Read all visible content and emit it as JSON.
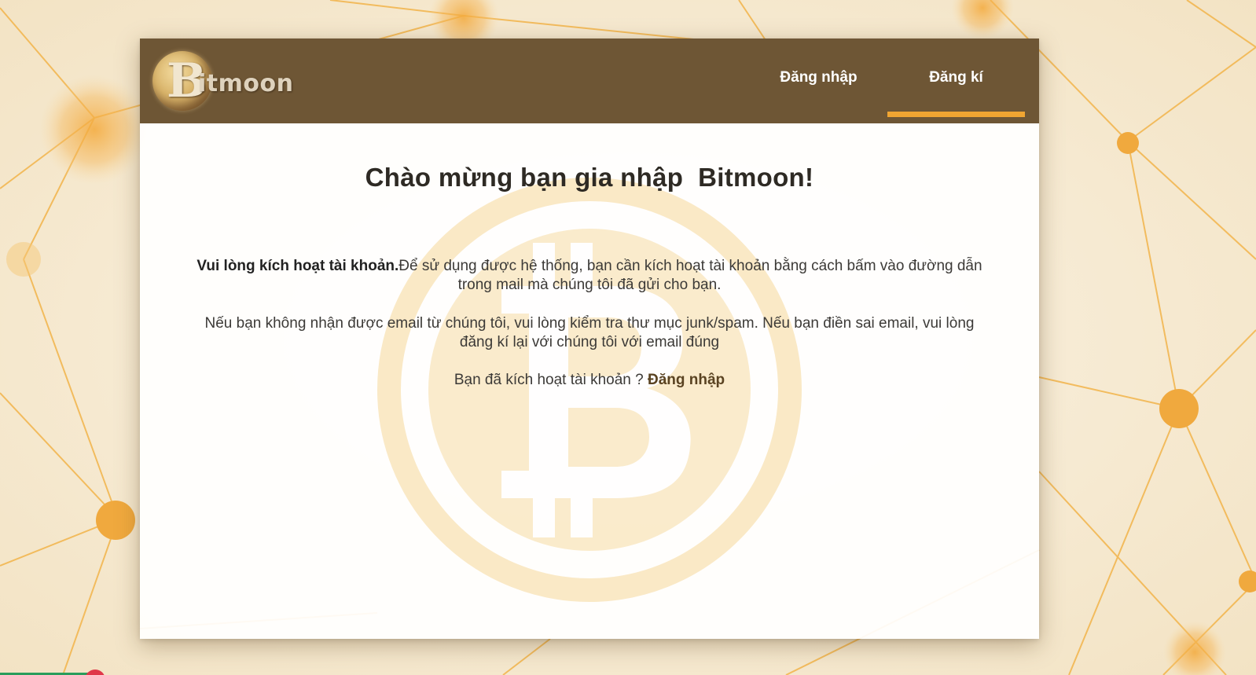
{
  "brand": {
    "logo_text": "Bitmoon",
    "logo_letter": "B"
  },
  "nav": {
    "login_label": "Đăng nhập",
    "register_label": "Đăng kí",
    "active_tab": "register"
  },
  "main": {
    "title": "Chào mừng bạn gia nhập  Bitmoon!",
    "activation_bold": "Vui lòng kích hoạt tài khoản.",
    "activation_text": "Để sử dụng được hệ thống, bạn cần kích hoạt tài khoản bằng cách bấm vào đường dẫn trong mail mà chúng tôi đã gửi cho bạn.",
    "no_email_text": "Nếu bạn không nhận được email từ chúng tôi, vui lòng kiểm tra thư mục junk/spam. Nếu bạn điền sai email, vui lòng đăng kí lại với chúng tôi với email đúng",
    "activated_question": "Bạn đã kích hoạt tài khoản ? ",
    "login_link": "Đăng nhập"
  },
  "colors": {
    "header_bg": "#6e5635",
    "accent": "#f0a532",
    "network": "#f2b44a",
    "page_bg": "#f6ead3"
  },
  "icons": {
    "watermark": "bitcoin-icon",
    "logo": "moon-bitcoin-logo"
  }
}
